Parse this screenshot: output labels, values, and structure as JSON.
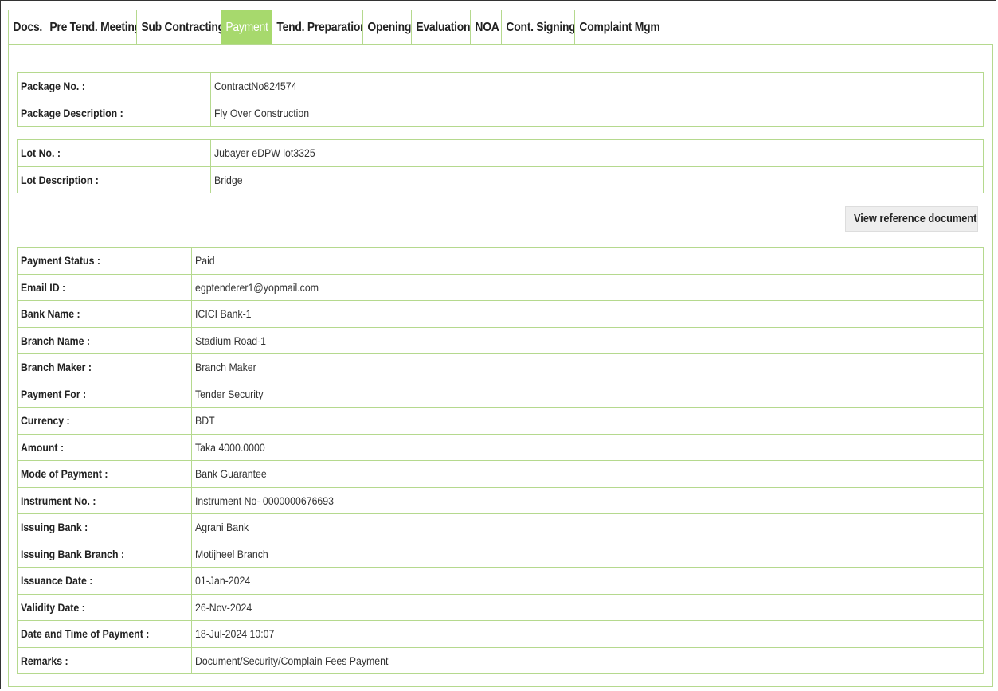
{
  "tabs": [
    {
      "label": "Docs.",
      "active": false
    },
    {
      "label": "Pre Tend. Meeting",
      "active": false
    },
    {
      "label": "Sub Contracting",
      "active": false
    },
    {
      "label": "Payment",
      "active": true
    },
    {
      "label": "Tend. Preparation",
      "active": false
    },
    {
      "label": "Opening",
      "active": false
    },
    {
      "label": "Evaluation",
      "active": false
    },
    {
      "label": "NOA",
      "active": false
    },
    {
      "label": "Cont. Signing",
      "active": false
    },
    {
      "label": "Complaint Mgmt",
      "active": false
    }
  ],
  "package": {
    "rows": [
      {
        "label": "Package No. :",
        "value": "ContractNo824574"
      },
      {
        "label": "Package Description :",
        "value": "Fly Over Construction"
      }
    ]
  },
  "lot": {
    "rows": [
      {
        "label": "Lot No. :",
        "value": "Jubayer eDPW lot3325"
      },
      {
        "label": "Lot Description :",
        "value": "Bridge"
      }
    ]
  },
  "reference_button": {
    "label": "View reference document",
    "icon": "document-icon"
  },
  "payment": {
    "rows": [
      {
        "label": "Payment Status :",
        "value": "Paid"
      },
      {
        "label": "Email ID :",
        "value": "egptenderer1@yopmail.com"
      },
      {
        "label": "Bank Name :",
        "value": "ICICI Bank-1"
      },
      {
        "label": "Branch Name :",
        "value": "Stadium Road-1"
      },
      {
        "label": "Branch Maker :",
        "value": "Branch Maker"
      },
      {
        "label": "Payment For :",
        "value": "Tender Security"
      },
      {
        "label": "Currency :",
        "value": "BDT"
      },
      {
        "label": "Amount :",
        "value": "Taka 4000.0000"
      },
      {
        "label": "Mode of Payment :",
        "value": "Bank Guarantee"
      },
      {
        "label": "Instrument No. :",
        "value": "Instrument No- 0000000676693"
      },
      {
        "label": "Issuing Bank :",
        "value": "Agrani Bank"
      },
      {
        "label": "Issuing Bank Branch :",
        "value": "Motijheel Branch"
      },
      {
        "label": "Issuance Date :",
        "value": "01-Jan-2024"
      },
      {
        "label": "Validity Date :",
        "value": "26-Nov-2024"
      },
      {
        "label": "Date and Time of Payment :",
        "value": "18-Jul-2024 10:07"
      },
      {
        "label": "Remarks :",
        "value": "Document/Security/Complain Fees Payment"
      }
    ]
  },
  "colors": {
    "border": "#b5d98e",
    "active_tab": "#a7d96d"
  }
}
